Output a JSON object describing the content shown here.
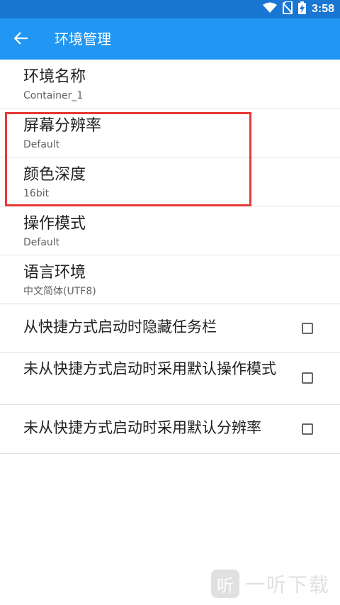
{
  "status_bar": {
    "time": "3:58"
  },
  "app_bar": {
    "title": "环境管理"
  },
  "settings": [
    {
      "title": "环境名称",
      "value": "Container_1"
    },
    {
      "title": "屏幕分辨率",
      "value": "Default"
    },
    {
      "title": "颜色深度",
      "value": "16bit"
    },
    {
      "title": "操作模式",
      "value": "Default"
    },
    {
      "title": "语言环境",
      "value": "中文简体(UTF8)"
    }
  ],
  "options": [
    {
      "label": "从快捷方式启动时隐藏任务栏",
      "checked": false
    },
    {
      "label": "未从快捷方式启动时采用默认操作模式",
      "checked": false
    },
    {
      "label": "未从快捷方式启动时采用默认分辨率",
      "checked": false
    }
  ],
  "watermark": {
    "logo_char": "听",
    "text": "一听下载"
  },
  "colors": {
    "status_bar": "#1976d2",
    "app_bar": "#2196f3",
    "highlight": "#e53935"
  }
}
